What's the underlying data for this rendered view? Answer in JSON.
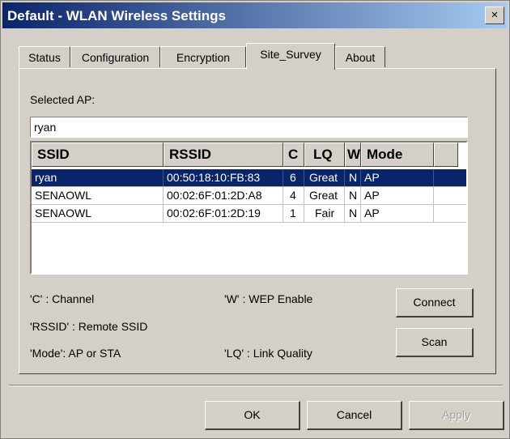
{
  "window": {
    "title": "Default - WLAN Wireless Settings",
    "close_glyph": "×"
  },
  "tabs": [
    {
      "label": "Status"
    },
    {
      "label": "Configuration"
    },
    {
      "label": "Encryption"
    },
    {
      "label": "Site_Survey",
      "active": true
    },
    {
      "label": "About"
    }
  ],
  "site_survey": {
    "selected_ap_label": "Selected AP:",
    "selected_ap_value": "ryan",
    "columns": [
      "SSID",
      "RSSID",
      "C",
      "LQ",
      "W",
      "Mode"
    ],
    "rows": [
      {
        "ssid": "ryan",
        "rssid": "00:50:18:10:FB:83",
        "c": "6",
        "lq": "Great",
        "w": "N",
        "mode": "AP",
        "selected": true
      },
      {
        "ssid": "SENAOWL",
        "rssid": "00:02:6F:01:2D:A8",
        "c": "4",
        "lq": "Great",
        "w": "N",
        "mode": "AP",
        "selected": false
      },
      {
        "ssid": "SENAOWL",
        "rssid": "00:02:6F:01:2D:19",
        "c": "1",
        "lq": "Fair",
        "w": "N",
        "mode": "AP",
        "selected": false
      }
    ],
    "legend": {
      "channel": "'C' : Channel",
      "rssid": "'RSSID' : Remote SSID",
      "mode": "'Mode': AP or STA",
      "wep": "'W' : WEP Enable",
      "lq": "'LQ' : Link Quality"
    },
    "connect_label": "Connect",
    "scan_label": "Scan"
  },
  "footer": {
    "ok_label": "OK",
    "cancel_label": "Cancel",
    "apply_label": "Apply"
  },
  "colors": {
    "face": "#d4d0c8",
    "title_start": "#0a246a",
    "title_end": "#a6caf0",
    "selection": "#0a246a"
  }
}
